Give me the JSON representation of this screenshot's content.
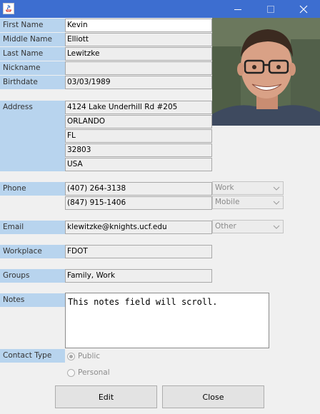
{
  "window": {
    "icon": "java-icon",
    "controls": [
      "minimize-icon",
      "maximize-icon",
      "close-icon"
    ]
  },
  "labels": {
    "first_name": "First Name",
    "middle_name": "Middle Name",
    "last_name": "Last Name",
    "nickname": "Nickname",
    "birthdate": "Birthdate",
    "address": "Address",
    "phone": "Phone",
    "email": "Email",
    "workplace": "Workplace",
    "groups": "Groups",
    "notes": "Notes",
    "contact_type": "Contact Type"
  },
  "contact": {
    "first_name": "Kevin",
    "middle_name": "Elliott",
    "last_name": "Lewitzke",
    "nickname": "",
    "birthdate": "03/03/1989",
    "address": {
      "street": "4124 Lake Underhill Rd #205",
      "city": "ORLANDO",
      "state": "FL",
      "zip": "32803",
      "country": "USA"
    },
    "phones": [
      {
        "number": "(407) 264-3138",
        "type": "Work"
      },
      {
        "number": "(847) 915-1406",
        "type": "Mobile"
      }
    ],
    "email": {
      "address": "klewitzke@knights.ucf.edu",
      "type": "Other"
    },
    "workplace": "FDOT",
    "groups": "Family, Work",
    "notes": "This notes field will scroll."
  },
  "contact_type": {
    "options": [
      "Public",
      "Personal"
    ],
    "selected": "Public"
  },
  "buttons": {
    "edit": "Edit",
    "close": "Close"
  },
  "colors": {
    "titlebar": "#3d6ed0",
    "label_bg": "#b8d4ee"
  }
}
